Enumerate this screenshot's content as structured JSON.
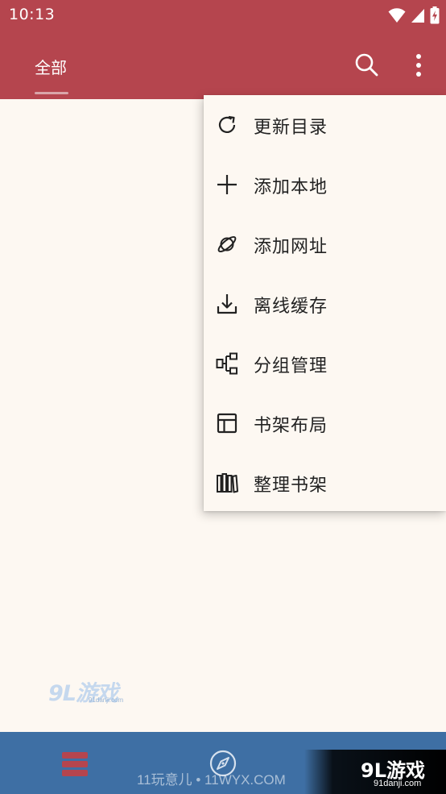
{
  "status_bar": {
    "time": "10:13",
    "icons": [
      "wifi-icon",
      "cell-signal-icon",
      "battery-charging-icon"
    ]
  },
  "app_bar": {
    "tab_label": "全部",
    "actions": [
      "search-icon",
      "more-vert-icon"
    ],
    "color": "#b5454e"
  },
  "menu": {
    "items": [
      {
        "label": "更新目录",
        "icon": "refresh-icon"
      },
      {
        "label": "添加本地",
        "icon": "plus-icon"
      },
      {
        "label": "添加网址",
        "icon": "planet-icon"
      },
      {
        "label": "离线缓存",
        "icon": "download-icon"
      },
      {
        "label": "分组管理",
        "icon": "group-icon"
      },
      {
        "label": "书架布局",
        "icon": "layout-icon"
      },
      {
        "label": "整理书架",
        "icon": "books-icon"
      }
    ]
  },
  "bottom_nav": {
    "items": [
      "bookshelf-icon",
      "compass-icon"
    ],
    "color": "#3e6fa4"
  },
  "watermarks": {
    "site_text": "11玩意儿 • 11WYX.COM",
    "logo_main": "9L游戏",
    "logo_sub": "91danji.com",
    "float_logo_main": "9L游戏",
    "float_logo_sub": "91danji.com"
  }
}
